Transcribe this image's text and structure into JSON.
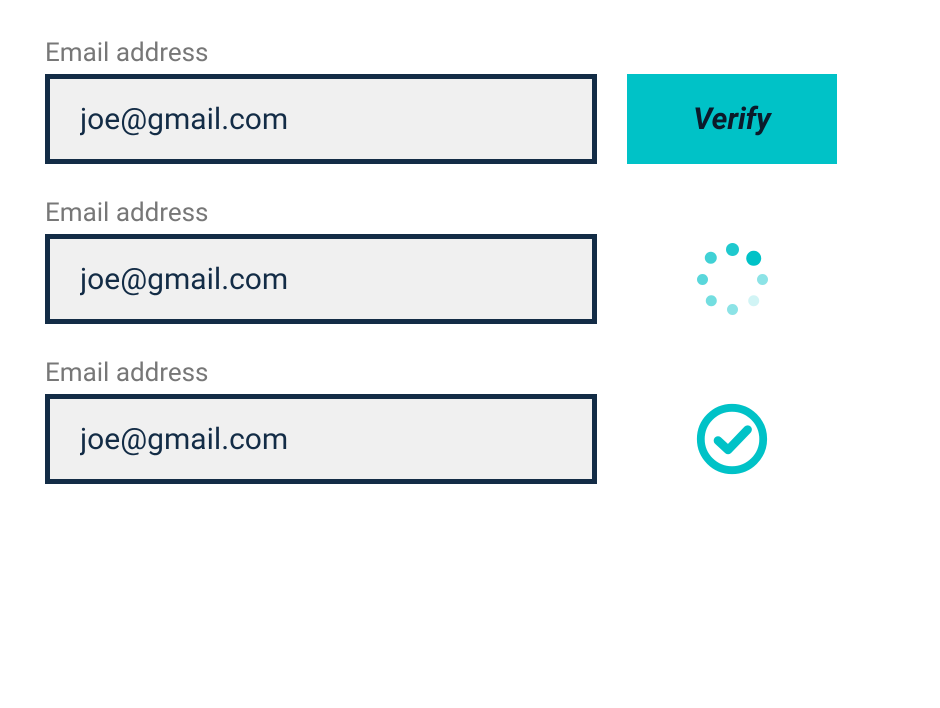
{
  "colors": {
    "border": "#132c46",
    "inputBg": "#f0f0f0",
    "accent": "#00c2c7",
    "labelText": "#777777",
    "inputText": "#132c46",
    "buttonText": "#0b1a2a"
  },
  "rows": {
    "verify": {
      "label": "Email address",
      "value": "joe@gmail.com",
      "button_label": "Verify"
    },
    "loading": {
      "label": "Email address",
      "value": "joe@gmail.com",
      "status": "loading"
    },
    "success": {
      "label": "Email address",
      "value": "joe@gmail.com",
      "status": "verified"
    }
  }
}
